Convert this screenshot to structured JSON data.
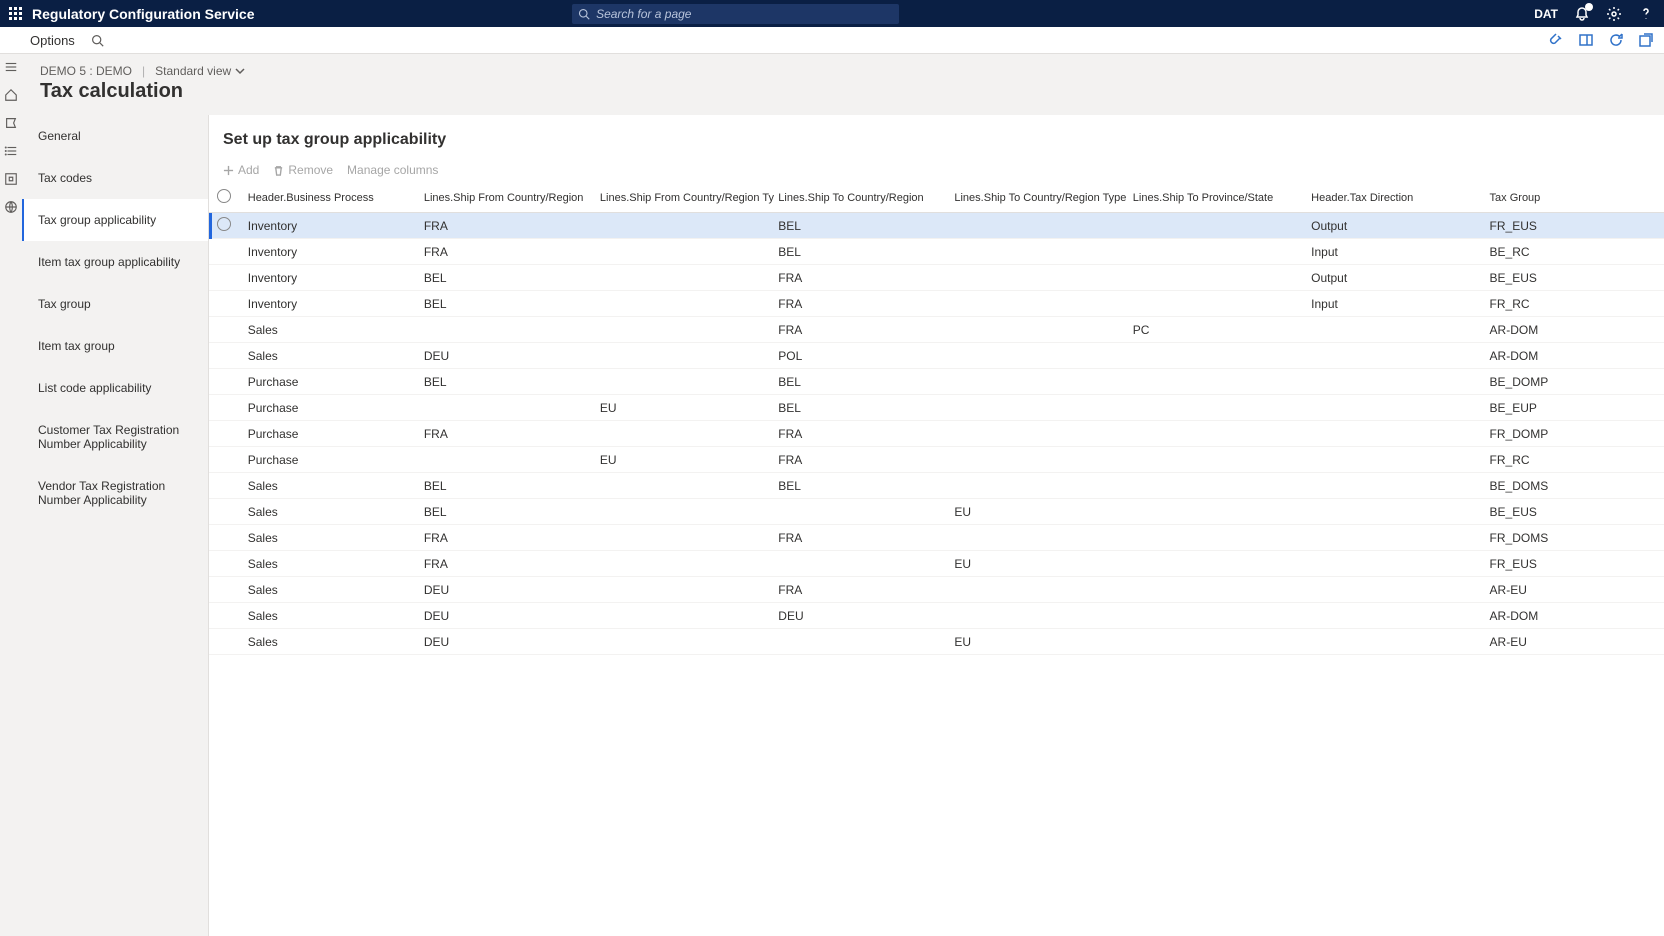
{
  "topbar": {
    "brand": "Regulatory Configuration Service",
    "search_placeholder": "Search for a page",
    "legal_entity": "DAT"
  },
  "actionbar": {
    "options": "Options"
  },
  "crumbs": {
    "path": "DEMO 5 : DEMO",
    "view": "Standard view"
  },
  "page_title": "Tax calculation",
  "sections": [
    "General",
    "Tax codes",
    "Tax group applicability",
    "Item tax group applicability",
    "Tax group",
    "Item tax group",
    "List code applicability",
    "Customer Tax Registration Number Applicability",
    "Vendor Tax Registration Number Applicability"
  ],
  "active_section_index": 2,
  "main": {
    "heading": "Set up tax group applicability",
    "toolbar": {
      "add": "Add",
      "remove": "Remove",
      "manage": "Manage columns"
    },
    "columns": [
      "Header.Business Process",
      "Lines.Ship From Country/Region",
      "Lines.Ship From Country/Region Type",
      "Lines.Ship To Country/Region",
      "Lines.Ship To Country/Region Type",
      "Lines.Ship To Province/State",
      "Header.Tax Direction",
      "Tax Group"
    ],
    "rows": [
      {
        "bp": "Inventory",
        "sfc": "FRA",
        "sfct": "",
        "stc": "BEL",
        "stct": "",
        "stps": "",
        "td": "Output",
        "tg": "FR_EUS"
      },
      {
        "bp": "Inventory",
        "sfc": "FRA",
        "sfct": "",
        "stc": "BEL",
        "stct": "",
        "stps": "",
        "td": "Input",
        "tg": "BE_RC"
      },
      {
        "bp": "Inventory",
        "sfc": "BEL",
        "sfct": "",
        "stc": "FRA",
        "stct": "",
        "stps": "",
        "td": "Output",
        "tg": "BE_EUS"
      },
      {
        "bp": "Inventory",
        "sfc": "BEL",
        "sfct": "",
        "stc": "FRA",
        "stct": "",
        "stps": "",
        "td": "Input",
        "tg": "FR_RC"
      },
      {
        "bp": "Sales",
        "sfc": "",
        "sfct": "",
        "stc": "FRA",
        "stct": "",
        "stps": "PC",
        "td": "",
        "tg": "AR-DOM"
      },
      {
        "bp": "Sales",
        "sfc": "DEU",
        "sfct": "",
        "stc": "POL",
        "stct": "",
        "stps": "",
        "td": "",
        "tg": "AR-DOM"
      },
      {
        "bp": "Purchase",
        "sfc": "BEL",
        "sfct": "",
        "stc": "BEL",
        "stct": "",
        "stps": "",
        "td": "",
        "tg": "BE_DOMP"
      },
      {
        "bp": "Purchase",
        "sfc": "",
        "sfct": "EU",
        "stc": "BEL",
        "stct": "",
        "stps": "",
        "td": "",
        "tg": "BE_EUP"
      },
      {
        "bp": "Purchase",
        "sfc": "FRA",
        "sfct": "",
        "stc": "FRA",
        "stct": "",
        "stps": "",
        "td": "",
        "tg": "FR_DOMP"
      },
      {
        "bp": "Purchase",
        "sfc": "",
        "sfct": "EU",
        "stc": "FRA",
        "stct": "",
        "stps": "",
        "td": "",
        "tg": "FR_RC"
      },
      {
        "bp": "Sales",
        "sfc": "BEL",
        "sfct": "",
        "stc": "BEL",
        "stct": "",
        "stps": "",
        "td": "",
        "tg": "BE_DOMS"
      },
      {
        "bp": "Sales",
        "sfc": "BEL",
        "sfct": "",
        "stc": "",
        "stct": "EU",
        "stps": "",
        "td": "",
        "tg": "BE_EUS"
      },
      {
        "bp": "Sales",
        "sfc": "FRA",
        "sfct": "",
        "stc": "FRA",
        "stct": "",
        "stps": "",
        "td": "",
        "tg": "FR_DOMS"
      },
      {
        "bp": "Sales",
        "sfc": "FRA",
        "sfct": "",
        "stc": "",
        "stct": "EU",
        "stps": "",
        "td": "",
        "tg": "FR_EUS"
      },
      {
        "bp": "Sales",
        "sfc": "DEU",
        "sfct": "",
        "stc": "FRA",
        "stct": "",
        "stps": "",
        "td": "",
        "tg": "AR-EU"
      },
      {
        "bp": "Sales",
        "sfc": "DEU",
        "sfct": "",
        "stc": "DEU",
        "stct": "",
        "stps": "",
        "td": "",
        "tg": "AR-DOM"
      },
      {
        "bp": "Sales",
        "sfc": "DEU",
        "sfct": "",
        "stc": "",
        "stct": "EU",
        "stps": "",
        "td": "",
        "tg": "AR-EU"
      }
    ],
    "selected_row_index": 0
  }
}
